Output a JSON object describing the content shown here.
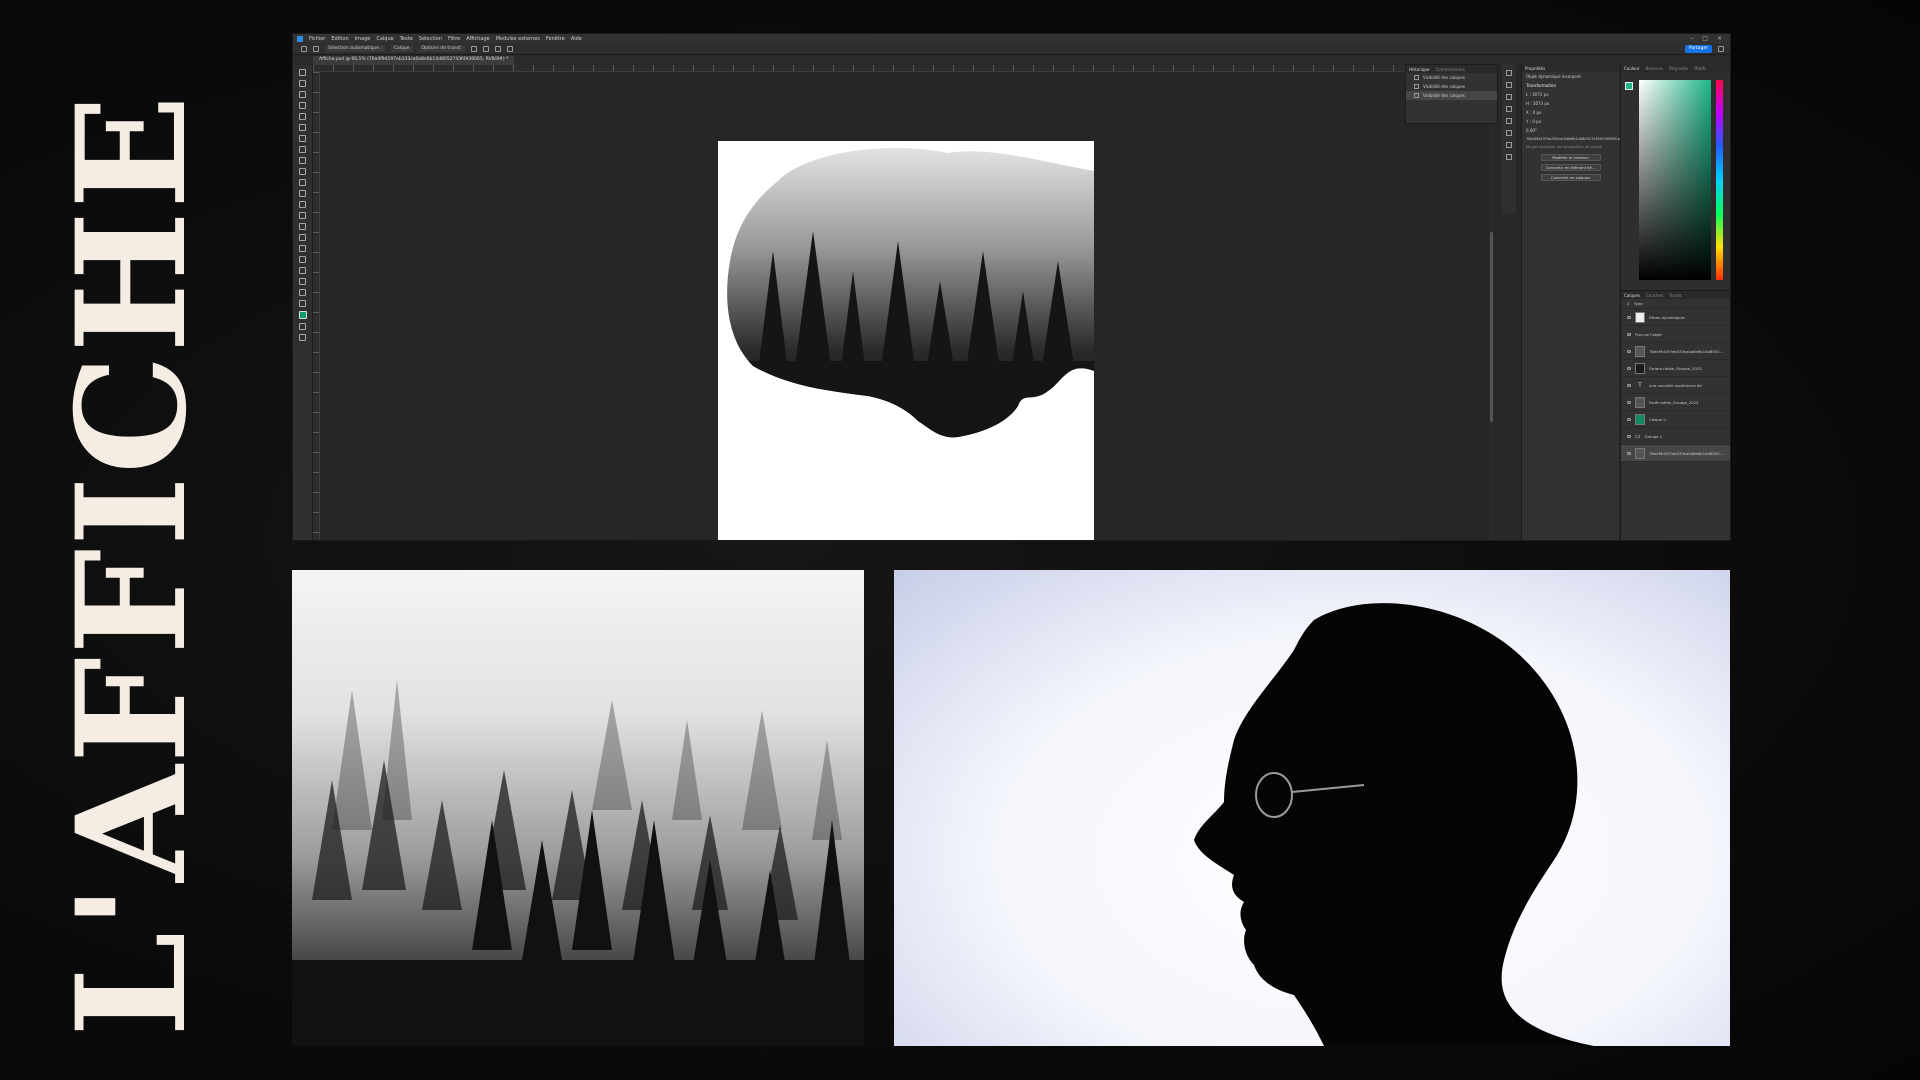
{
  "title": "L'AFFICHE",
  "photoshop": {
    "menu": [
      "Fichier",
      "Edition",
      "Image",
      "Calque",
      "Texte",
      "Sélection",
      "Filtre",
      "Affichage",
      "Modules externes",
      "Fenêtre",
      "Aide"
    ],
    "options": [
      "Sélection automatique :",
      "Calque",
      "Options de transf."
    ],
    "share_label": "Partager",
    "document_tab": "Affiche.psd @ 66,1% (76e4f9d197eb333ca0a8e6b14d8052743f4930065, RVB/8#) *",
    "history": {
      "tabs": [
        "Historique",
        "Commentaires"
      ],
      "rows": [
        "Visibilité des calques",
        "Visibilité des calques",
        "Visibilité des calques"
      ]
    },
    "properties": {
      "title": "Propriétés",
      "object": "Objet dynamique incorporé",
      "section": "Transformation",
      "w": "L : 3073 px",
      "h": "H : 3073 px",
      "x": "X : 0 px",
      "y": "Y : 0 px",
      "angle": "0,00°",
      "filename": "76e4f9d197eb333ca0a8e6b14d8052743f49300065.psb",
      "note": "Ne pas appliquer de composition de calque",
      "buttons": [
        "Modifier le contenu",
        "Convertir en élément lié...",
        "Convertir en calques"
      ]
    },
    "color_panel": {
      "tabs": [
        "Couleur",
        "Nuances",
        "Dégradés",
        "Motifs"
      ],
      "foreground": "#1fb589"
    },
    "layers": {
      "tabs": [
        "Calques",
        "Couches",
        "Tracés"
      ],
      "filter_label": "Type",
      "rows": [
        "Filtres dynamiques",
        "Flou de l'objet",
        "76e4f9d197eb333ca0a8e6b14d8052...",
        "Ombre-rafale_Groupe_2023",
        "une nouvelle expérience de",
        "Forêt-rafale_Groupe_2023",
        "Calque 0",
        "Groupe 1",
        "76e4f9d197eb333ca0a8e6b14d8052..."
      ]
    }
  }
}
